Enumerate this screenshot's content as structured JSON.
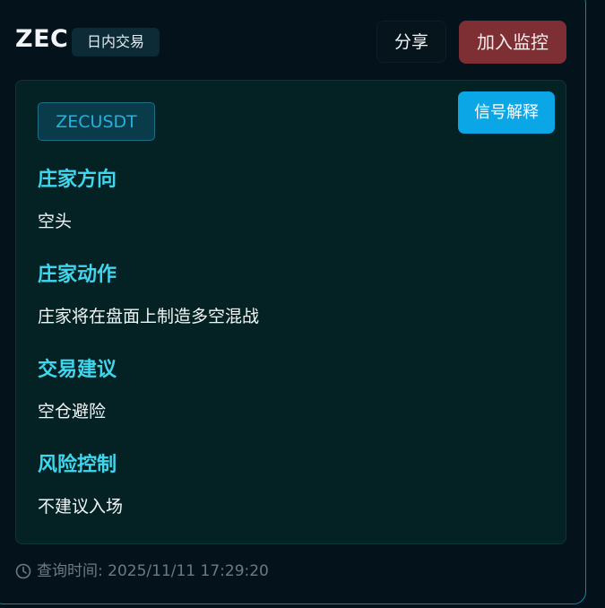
{
  "header": {
    "symbol": "ZEC",
    "type_tag": "日内交易",
    "share_label": "分享",
    "watch_label": "加入监控"
  },
  "panel": {
    "pair": "ZECUSDT",
    "explain_label": "信号解释",
    "sections": [
      {
        "title": "庄家方向",
        "value": "空头"
      },
      {
        "title": "庄家动作",
        "value": "庄家将在盘面上制造多空混战"
      },
      {
        "title": "交易建议",
        "value": "空仓避险"
      },
      {
        "title": "风险控制",
        "value": "不建议入场"
      }
    ]
  },
  "footer": {
    "icon": "clock-icon",
    "text": "查询时间: 2025/11/11 17:29:20"
  },
  "colors": {
    "accent_cyan": "#3fd6ee",
    "watch_red": "#7d2f34",
    "explain_blue": "#0aa6e6",
    "border_blue": "#0b86b5"
  }
}
